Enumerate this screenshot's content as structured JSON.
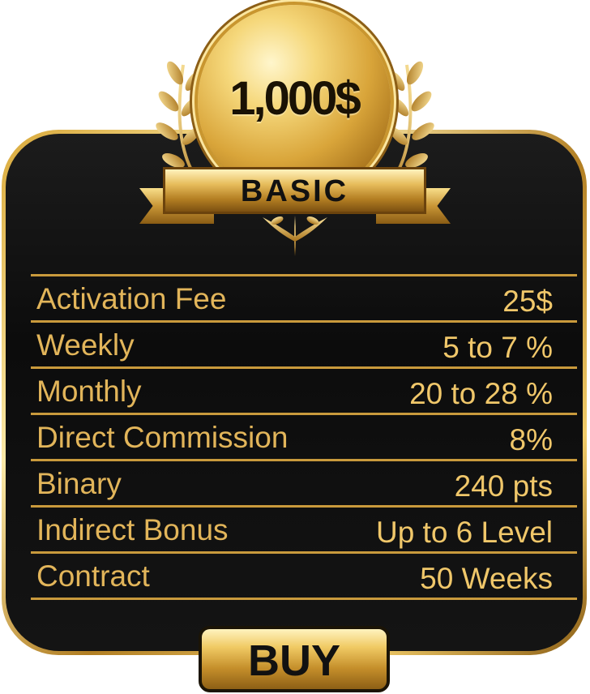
{
  "plan": {
    "price": "1,000$",
    "name": "BASIC"
  },
  "features": [
    {
      "label": "Activation Fee",
      "value": "25$"
    },
    {
      "label": "Weekly",
      "value": "5 to 7 %"
    },
    {
      "label": "Monthly",
      "value": "20 to 28 %"
    },
    {
      "label": "Direct Commission",
      "value": "8%"
    },
    {
      "label": "Binary",
      "value": "240 pts"
    },
    {
      "label": "Indirect Bonus",
      "value": "Up to 6 Level"
    },
    {
      "label": "Contract",
      "value": "50 Weeks"
    }
  ],
  "buy_label": "BUY",
  "colors": {
    "gold": "#e2b55a",
    "dark": "#111111"
  }
}
